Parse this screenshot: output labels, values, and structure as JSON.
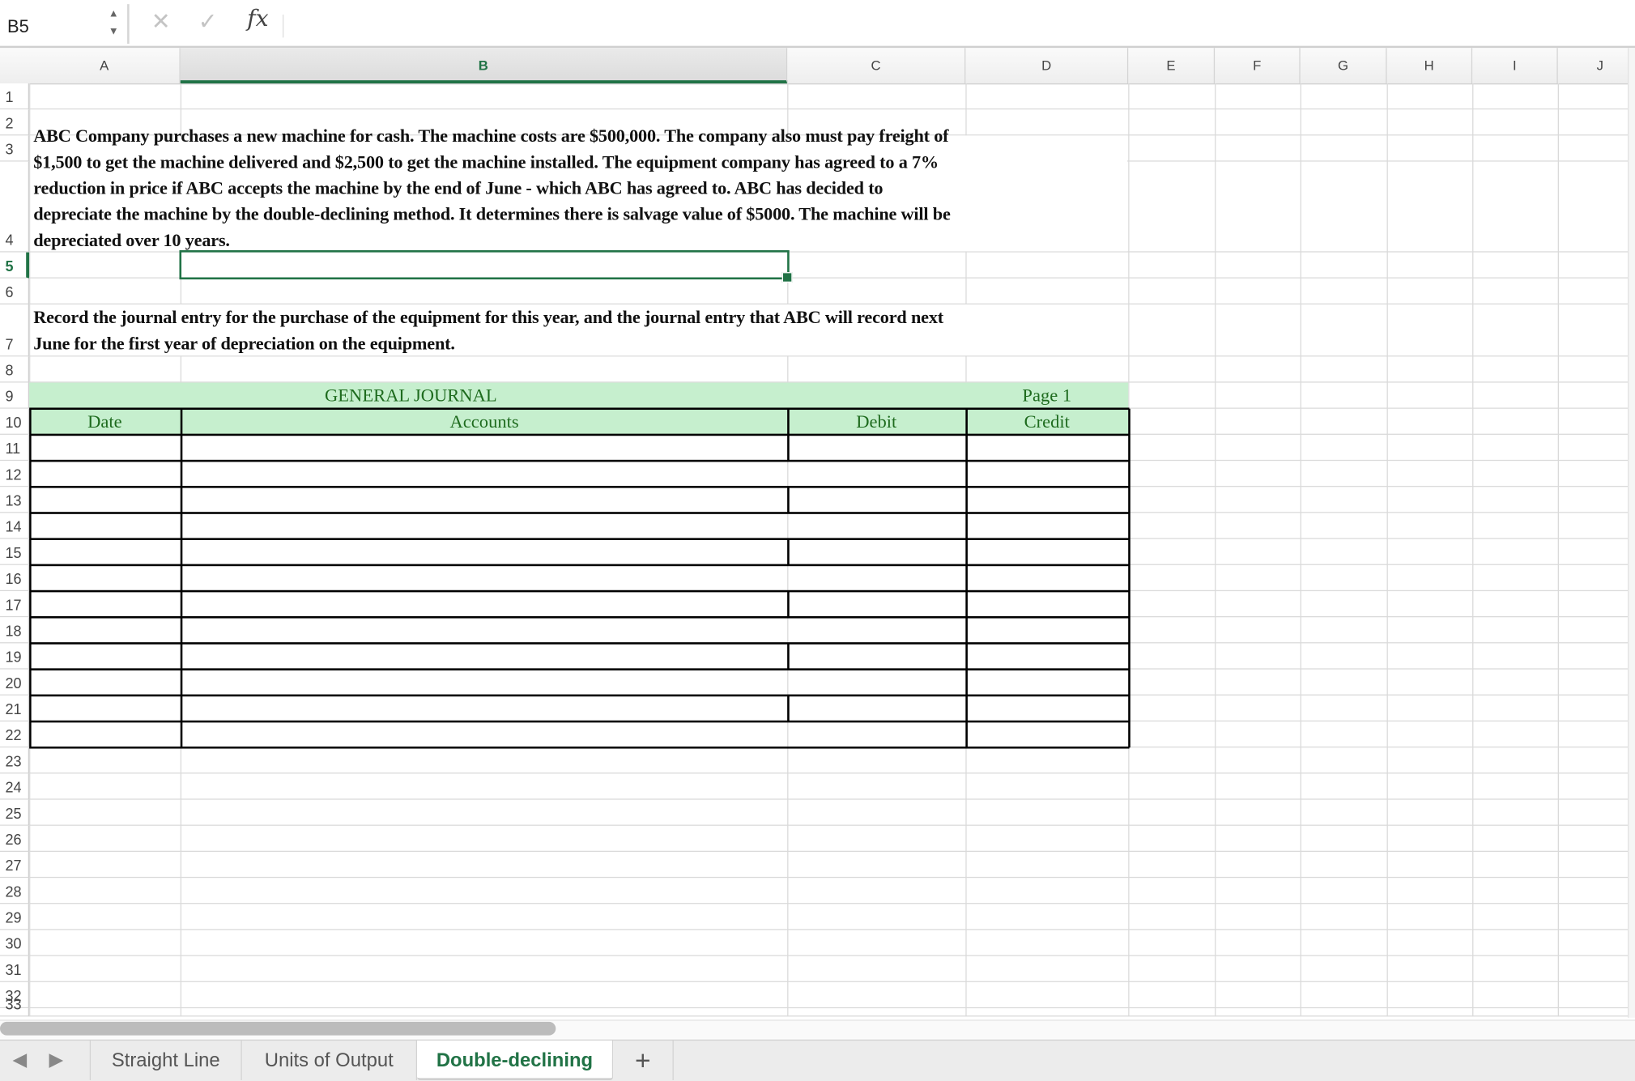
{
  "formula_bar": {
    "name_box": "B5",
    "cancel_icon": "x-icon",
    "enter_icon": "check-icon",
    "function_label": "fx",
    "formula": ""
  },
  "columns": [
    "A",
    "B",
    "C",
    "D",
    "E",
    "F",
    "G",
    "H",
    "I",
    "J"
  ],
  "selected_column": "B",
  "rows": [
    "1",
    "2",
    "3",
    "4",
    "5",
    "6",
    "7",
    "8",
    "9",
    "10",
    "11",
    "12",
    "13",
    "14",
    "15",
    "16",
    "17",
    "18",
    "19",
    "20",
    "21",
    "22",
    "23",
    "24",
    "25",
    "26",
    "27",
    "28",
    "29",
    "30",
    "31",
    "32",
    "33"
  ],
  "selected_row": "5",
  "selected_cell": "B5",
  "problem_text": [
    "ABC Company purchases a new machine for cash. The machine costs are $500,000. The company also must pay freight of",
    "$1,500 to get the machine delivered and $2,500 to get the machine installed. The equipment company has agreed to a 7%",
    "reduction in price if ABC accepts the machine by the end of June - which ABC has agreed to. ABC has decided to",
    "depreciate the machine by the double-declining method. It determines there is salvage value of $5000. The machine will be",
    "depreciated over 10 years."
  ],
  "instruction_text": [
    "Record the journal entry for the purchase of the equipment for this year, and the journal entry that ABC will record next",
    "June for the first year of depreciation on the equipment."
  ],
  "journal": {
    "title": "GENERAL JOURNAL",
    "page": "Page 1",
    "headers": {
      "date": "Date",
      "accounts": "Accounts",
      "debit": "Debit",
      "credit": "Credit"
    },
    "header_fill": "#c6efce",
    "header_text_color": "#1e6b1e"
  },
  "sheet_tabs": [
    {
      "label": "Straight Line",
      "active": false
    },
    {
      "label": "Units of Output",
      "active": false
    },
    {
      "label": "Double-declining",
      "active": true
    }
  ],
  "add_sheet_label": "+",
  "accent_color": "#217346"
}
